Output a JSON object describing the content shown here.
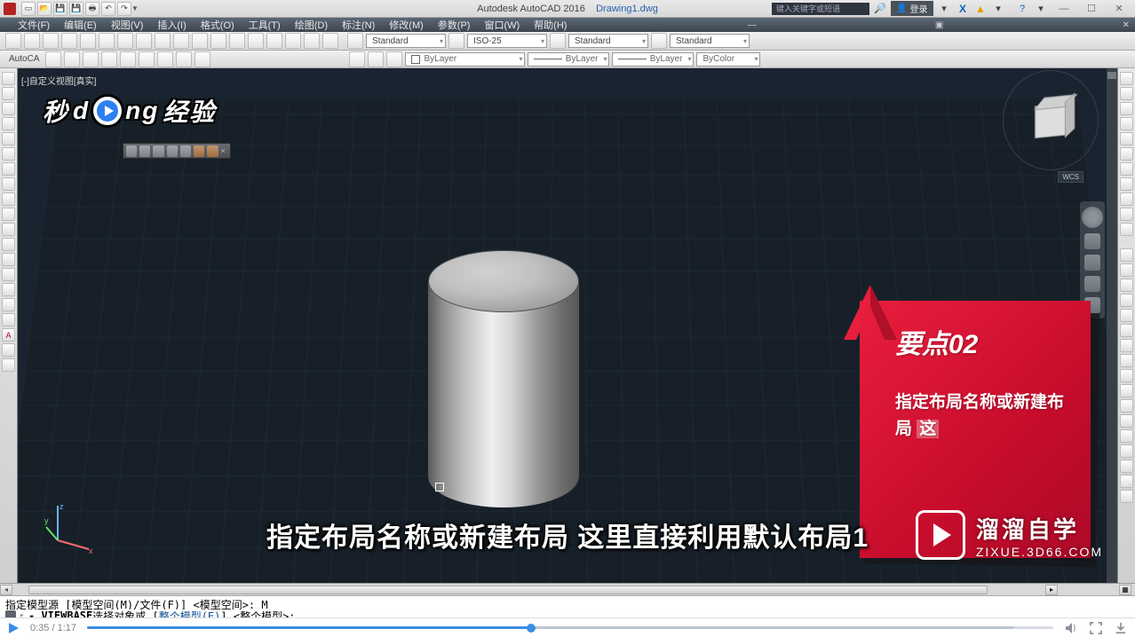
{
  "app": {
    "name": "Autodesk AutoCAD 2016",
    "filename": "Drawing1.dwg"
  },
  "qat": {
    "search_placeholder": "键入关键字或短语",
    "login": "登录"
  },
  "menu": {
    "items": [
      "文件(F)",
      "编辑(E)",
      "视图(V)",
      "插入(I)",
      "格式(O)",
      "工具(T)",
      "绘图(D)",
      "标注(N)",
      "修改(M)",
      "参数(P)",
      "窗口(W)",
      "帮助(H)"
    ]
  },
  "toolbar1": {
    "style1": "Standard",
    "style2": "ISO-25",
    "style3": "Standard",
    "style4": "Standard"
  },
  "toolbar2": {
    "label": "AutoCA",
    "layer": "ByLayer",
    "linetype": "ByLayer",
    "lineweight": "ByLayer",
    "color": "ByColor"
  },
  "canvas": {
    "view_label": "[-]自定义视图[真实]",
    "wcs": "WCS"
  },
  "annotation": {
    "title": "要点02",
    "body": "指定布局名称或新建布局",
    "highlight": "这"
  },
  "caption": "指定布局名称或新建布局 这里直接利用默认布局1",
  "command": {
    "line1": "指定模型源 [模型空间(M)/文件(F)] <模型空间>: M",
    "line2_name": "VIEWBASE",
    "line2_rest": " 选择对象或 [",
    "line2_link": "整个模型(E)",
    "line2_rest2": "] <整个模型>:"
  },
  "brand_overlay": {
    "p1": "秒",
    "p2": "d",
    "p3": "ng",
    "p4": "经验"
  },
  "watermark": {
    "line1": "溜溜自学",
    "line2": "ZIXUE.3D66.COM"
  },
  "player": {
    "current": "0:35",
    "duration": "1:17"
  }
}
